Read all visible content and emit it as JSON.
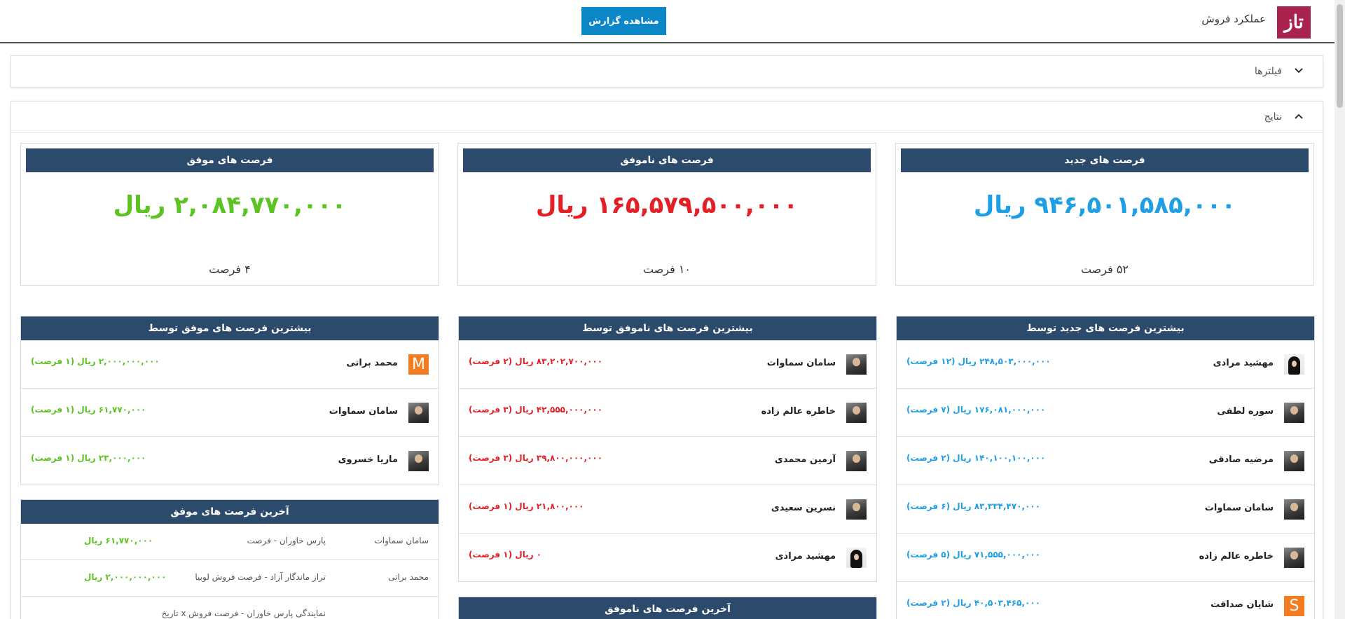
{
  "header": {
    "app_title": "عملکرد فروش",
    "logo_text": "ﺗﺎﺯ",
    "view_report_label": "مشاهده گزارش"
  },
  "filters": {
    "label": "فیلترها"
  },
  "results": {
    "label": "نتایج"
  },
  "kpis": {
    "new": {
      "title": "فرصت های جدید",
      "value": "۹۴۶,۵۰۱,۵۸۵,۰۰۰ ریال",
      "count": "۵۲ فرصت",
      "color": "#1e9ee5"
    },
    "failed": {
      "title": "فرصت های ناموفق",
      "value": "۱۶۵,۵۷۹,۵۰۰,۰۰۰ ریال",
      "count": "۱۰ فرصت",
      "color": "#e41f26"
    },
    "won": {
      "title": "فرصت های موفق",
      "value": "۲,۰۸۴,۷۷۰,۰۰۰ ریال",
      "count": "۴ فرصت",
      "color": "#5cc322"
    }
  },
  "top_new": {
    "title": "بیشترین فرصت های جدید توسط",
    "rows": [
      {
        "name": "مهشید مرادی",
        "amount": "۲۴۸,۵۰۳,۰۰۰,۰۰۰ ریال (۱۲ فرصت)",
        "avatar": "hijab"
      },
      {
        "name": "سوره لطفی",
        "amount": "۱۷۶,۰۸۱,۰۰۰,۰۰۰ ریال (۷ فرصت)",
        "avatar": "photo"
      },
      {
        "name": "مرضیه صادقی",
        "amount": "۱۴۰,۱۰۰,۱۰۰,۰۰۰ ریال (۲ فرصت)",
        "avatar": "photo"
      },
      {
        "name": "سامان سماوات",
        "amount": "۸۳,۳۳۴,۴۷۰,۰۰۰ ریال (۶ فرصت)",
        "avatar": "photo"
      },
      {
        "name": "خاطره عالم زاده",
        "amount": "۷۱,۵۵۵,۰۰۰,۰۰۰ ریال (۵ فرصت)",
        "avatar": "photo"
      },
      {
        "name": "شایان صداقت",
        "amount": "۴۰,۵۰۳,۴۶۵,۰۰۰ ریال (۲ فرصت)",
        "avatar": "letter",
        "letter": "S"
      }
    ]
  },
  "top_failed": {
    "title": "بیشترین فرصت های ناموفق توسط",
    "rows": [
      {
        "name": "سامان سماوات",
        "amount": "۸۳,۲۰۲,۷۰۰,۰۰۰ ریال (۲ فرصت)",
        "avatar": "photo"
      },
      {
        "name": "خاطره عالم زاده",
        "amount": "۴۲,۵۵۵,۰۰۰,۰۰۰ ریال (۳ فرصت)",
        "avatar": "photo"
      },
      {
        "name": "آرمین محمدی",
        "amount": "۳۹,۸۰۰,۰۰۰,۰۰۰ ریال (۳ فرصت)",
        "avatar": "photo"
      },
      {
        "name": "نسرین سعیدی",
        "amount": "۲۱,۸۰۰,۰۰۰ ریال (۱ فرصت)",
        "avatar": "photo"
      },
      {
        "name": "مهشید مرادی",
        "amount": "۰ ریال (۱ فرصت)",
        "avatar": "hijab"
      }
    ]
  },
  "top_won": {
    "title": "بیشترین فرصت های موفق توسط",
    "rows": [
      {
        "name": "محمد براتی",
        "amount": "۲,۰۰۰,۰۰۰,۰۰۰ ریال (۱ فرصت)",
        "avatar": "letter",
        "letter": "M"
      },
      {
        "name": "سامان سماوات",
        "amount": "۶۱,۷۷۰,۰۰۰ ریال (۱ فرصت)",
        "avatar": "photo"
      },
      {
        "name": "ماریا خسروی",
        "amount": "۲۳,۰۰۰,۰۰۰ ریال (۱ فرصت)",
        "avatar": "photo"
      }
    ]
  },
  "recent_won": {
    "title": "آخرین فرصت های موفق",
    "rows": [
      {
        "name": "سامان سماوات",
        "opportunity": "پارس خاوران - فرصت",
        "amount": "۶۱,۷۷۰,۰۰۰ ریال"
      },
      {
        "name": "محمد براتی",
        "opportunity": "تراز ماندگار آزاد - فرصت فروش لوبیا",
        "amount": "۲,۰۰۰,۰۰۰,۰۰۰ ریال"
      },
      {
        "name": "",
        "opportunity": "نمایندگی پارس خاوران - فرصت فروش x تاریخ",
        "amount": ""
      }
    ]
  },
  "recent_failed": {
    "title": "آخرین فرصت های ناموفق"
  }
}
